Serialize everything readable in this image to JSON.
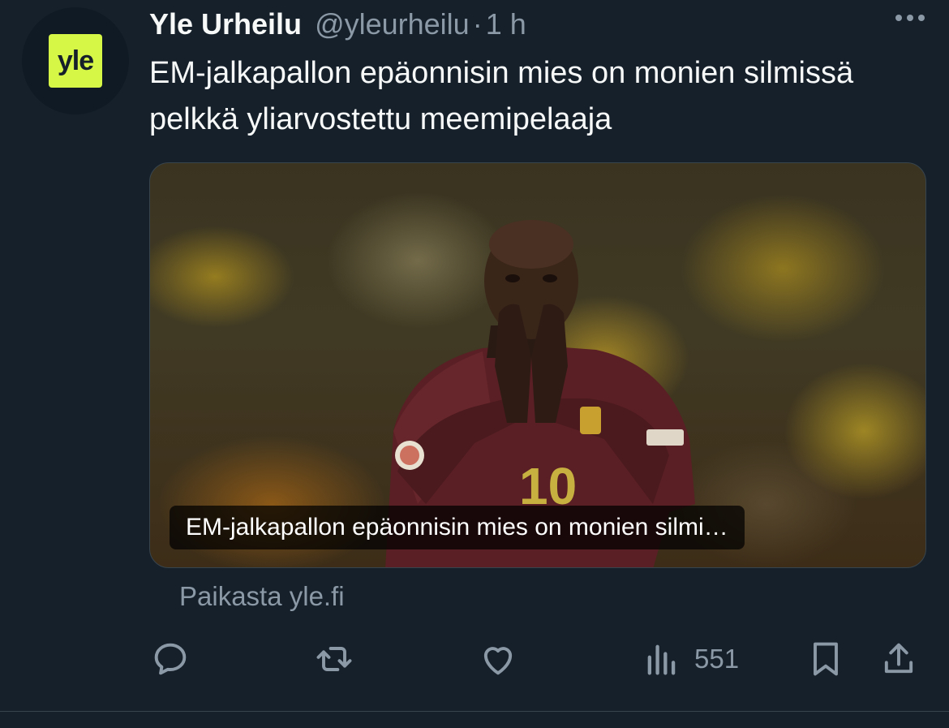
{
  "tweet": {
    "display_name": "Yle Urheilu",
    "handle": "@yleurheilu",
    "separator": "·",
    "time": "1 h",
    "text": "EM-jalkapallon epäonnisin mies on monien silmissä pelkkä yliarvostettu meemipelaaja",
    "avatar_logo_text": "yle"
  },
  "card": {
    "caption": "EM-jalkapallon epäonnisin mies on monien silmi…",
    "jersey_number": "10",
    "source": "Paikasta yle.fi"
  },
  "actions": {
    "reply_icon": "reply-icon",
    "retweet_icon": "retweet-icon",
    "like_icon": "heart-icon",
    "views_icon": "views-chart-icon",
    "views_count": "551",
    "bookmark_icon": "bookmark-icon",
    "share_icon": "share-icon"
  },
  "colors": {
    "background": "#15202b",
    "text_primary": "#f7f9f9",
    "text_secondary": "#8b98a5",
    "yle_brand": "#d7f746"
  }
}
